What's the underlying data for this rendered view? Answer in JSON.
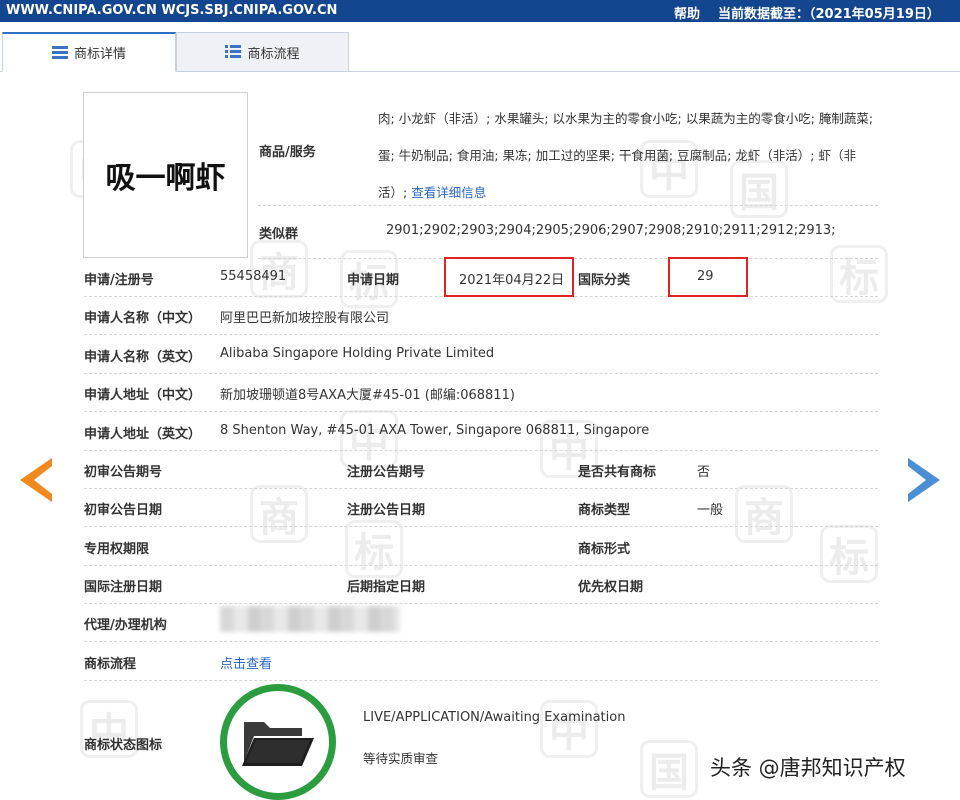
{
  "topbar": {
    "site": "WWW.CNIPA.GOV.CN WCJS.SBJ.CNIPA.GOV.CN",
    "help": "帮助",
    "date": "当前数据截至：（2021年05月19日）"
  },
  "tabs": {
    "details": "商标详情",
    "flow": "商标流程"
  },
  "trademark": {
    "name": "吸一啊虾",
    "goods_label": "商品/服务",
    "goods_text": "肉; 小龙虾（非活）; 水果罐头; 以水果为主的零食小吃; 以果蔬为主的零食小吃; 腌制蔬菜; 蛋; 牛奶制品; 食用油; 果冻; 加工过的坚果; 干食用菌; 豆腐制品; 龙虾（非活）; 虾（非活）;",
    "goods_link": "查看详细信息",
    "similar_label": "类似群",
    "similar_value": "2901;2902;2903;2904;2905;2906;2907;2908;2910;2911;2912;2913;",
    "reg_no_label": "申请/注册号",
    "reg_no": "55458491",
    "apply_date_label": "申请日期",
    "apply_date": "2021年04月22日",
    "intl_class_label": "国际分类",
    "intl_class": "29",
    "applicant_cn_label": "申请人名称（中文）",
    "applicant_cn": "阿里巴巴新加坡控股有限公司",
    "applicant_en_label": "申请人名称（英文）",
    "applicant_en": "Alibaba Singapore Holding Private Limited",
    "address_cn_label": "申请人地址（中文）",
    "address_cn": "新加坡珊顿道8号AXA大厦#45-01 (邮编:068811)",
    "address_en_label": "申请人地址（英文）",
    "address_en": "8 Shenton Way, #45-01 AXA Tower, Singapore 068811, Singapore",
    "prelim_no_label": "初审公告期号",
    "reg_ann_no_label": "注册公告期号",
    "shared_label": "是否共有商标",
    "shared_value": "否",
    "prelim_date_label": "初审公告日期",
    "reg_ann_date_label": "注册公告日期",
    "type_label": "商标类型",
    "type_value": "一般",
    "exclusive_label": "专用权期限",
    "form_label": "商标形式",
    "intl_reg_date_label": "国际注册日期",
    "later_date_label": "后期指定日期",
    "priority_date_label": "优先权日期",
    "agent_label": "代理/办理机构",
    "flow_label": "商标流程",
    "flow_link": "点击查看",
    "status_label": "商标状态图标",
    "status_en": "LIVE/APPLICATION/Awaiting Examination",
    "status_cn": "等待实质审查"
  },
  "watermark": "头条 @唐邦知识产权",
  "colors": {
    "topbar": "#13468f",
    "link": "#2968c8",
    "highlight": "#e02424",
    "status_ring": "#2b9d3e",
    "arrow_left": "#f08a1d",
    "arrow_right": "#4a8fd4"
  }
}
